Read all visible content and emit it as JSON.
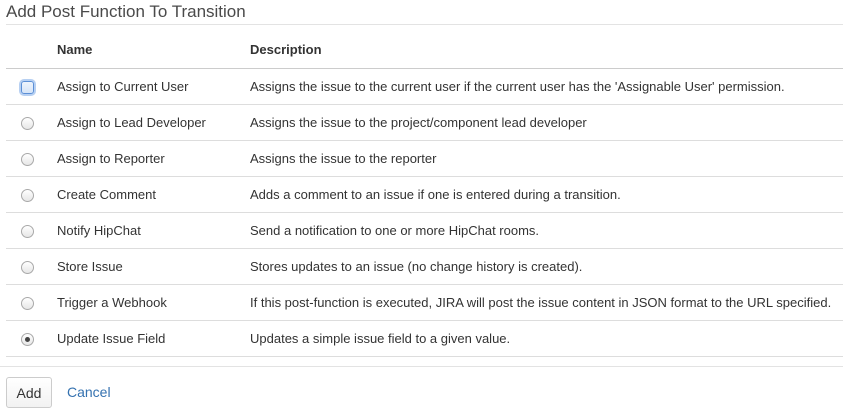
{
  "dialog": {
    "title": "Add Post Function To Transition"
  },
  "table": {
    "headers": {
      "name": "Name",
      "description": "Description"
    },
    "rows": [
      {
        "name": "Assign to Current User",
        "description": "Assigns the issue to the current user if the current user has the 'Assignable User' permission.",
        "checked": false,
        "focused": true
      },
      {
        "name": "Assign to Lead Developer",
        "description": "Assigns the issue to the project/component lead developer",
        "checked": false,
        "focused": false
      },
      {
        "name": "Assign to Reporter",
        "description": "Assigns the issue to the reporter",
        "checked": false,
        "focused": false
      },
      {
        "name": "Create Comment",
        "description": "Adds a comment to an issue if one is entered during a transition.",
        "checked": false,
        "focused": false
      },
      {
        "name": "Notify HipChat",
        "description": "Send a notification to one or more HipChat rooms.",
        "checked": false,
        "focused": false
      },
      {
        "name": "Store Issue",
        "description": "Stores updates to an issue (no change history is created).",
        "checked": false,
        "focused": false
      },
      {
        "name": "Trigger a Webhook",
        "description": "If this post-function is executed, JIRA will post the issue content in JSON format to the URL specified.",
        "checked": false,
        "focused": false
      },
      {
        "name": "Update Issue Field",
        "description": "Updates a simple issue field to a given value.",
        "checked": true,
        "focused": false
      }
    ]
  },
  "actions": {
    "add_label": "Add",
    "cancel_label": "Cancel"
  },
  "colors": {
    "link": "#3572b0",
    "focus": "#5b8fd6"
  }
}
